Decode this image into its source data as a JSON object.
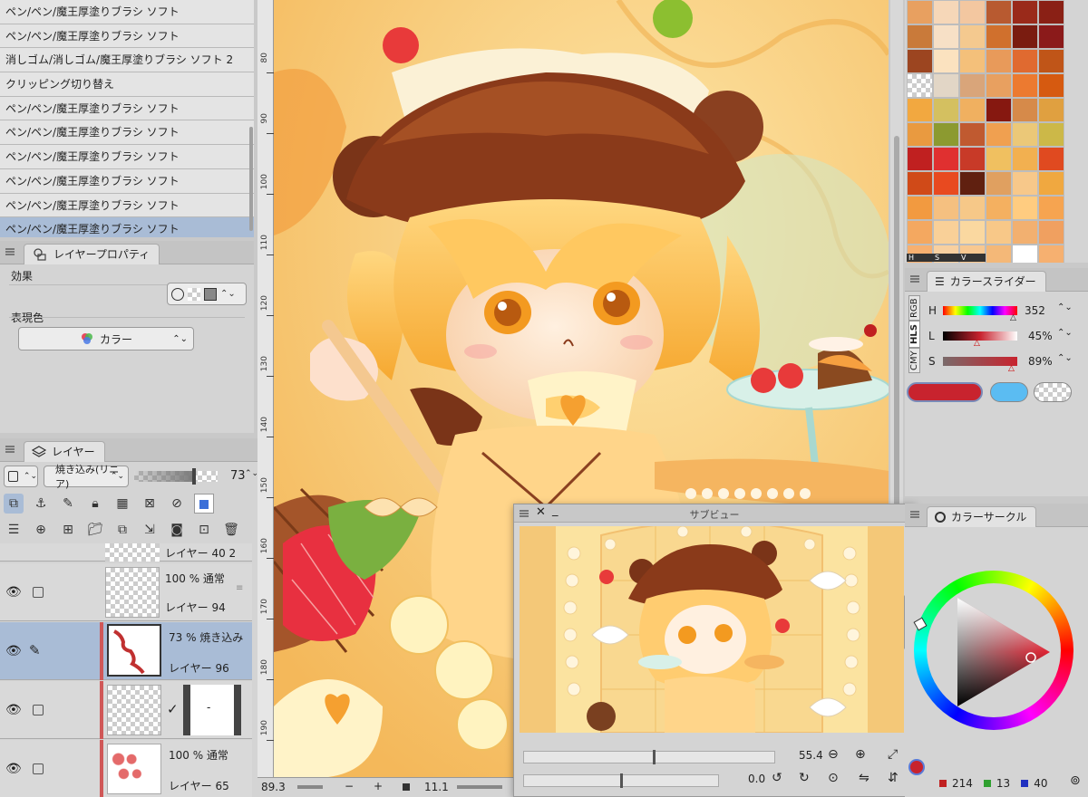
{
  "history": {
    "items": [
      "ペン/ペン/魔王厚塗りブラシ ソフト",
      "ペン/ペン/魔王厚塗りブラシ ソフト",
      "消しゴム/消しゴム/魔王厚塗りブラシ ソフト 2",
      "クリッピング切り替え",
      "ペン/ペン/魔王厚塗りブラシ ソフト",
      "ペン/ペン/魔王厚塗りブラシ ソフト",
      "ペン/ペン/魔王厚塗りブラシ ソフト",
      "ペン/ペン/魔王厚塗りブラシ ソフト",
      "ペン/ペン/魔王厚塗りブラシ ソフト",
      "ペン/ペン/魔王厚塗りブラシ ソフト"
    ]
  },
  "layer_property": {
    "tab_label": "レイヤープロパティ",
    "effect_label": "効果",
    "expression_label": "表現色",
    "expression_value": "カラー"
  },
  "layers": {
    "tab_label": "レイヤー",
    "blend_mode": "焼き込み(リニア)",
    "opacity": "73",
    "rows": [
      {
        "mode": "",
        "name": "レイヤー 40 2"
      },
      {
        "mode": "100 % 通常",
        "name": "レイヤー 94"
      },
      {
        "mode": "73 % 焼き込み",
        "name": "レイヤー 96"
      },
      {
        "mode": "",
        "name": ""
      },
      {
        "mode": "100 % 通常",
        "name": "レイヤー 65"
      }
    ],
    "mask_glyph": "-"
  },
  "canvas": {
    "ruler_marks": [
      "80",
      "90",
      "100",
      "110",
      "120",
      "130",
      "140",
      "150",
      "160",
      "170",
      "180",
      "190"
    ],
    "zoom": "89.3",
    "rotation": "11.1"
  },
  "subview": {
    "title": "サブビュー",
    "zoom": "55.4",
    "rotation": "0.0"
  },
  "color_slider": {
    "tab_label": "カラースライダー",
    "modes": [
      "RGB",
      "HLS",
      "CMY"
    ],
    "h_label": "H",
    "h_value": "352",
    "l_label": "L",
    "l_value": "45%",
    "s_label": "S",
    "s_value": "89%",
    "main_color": "#c8232e",
    "sub_color": "#5bbcf2"
  },
  "color_circle": {
    "tab_label": "カラーサークル",
    "r_value": "214",
    "g_value": "13",
    "b_value": "40"
  },
  "swatches": {
    "colors": [
      "#e8a060",
      "#f6d7b8",
      "#f3c7a0",
      "#b85a30",
      "#9a2a1a",
      "#8a2015",
      "#c97a3a",
      "#f7e0c6",
      "#f4c98f",
      "#d0702d",
      "#7a1c10",
      "#8b1a1a",
      "#9c4520",
      "#fbe2bf",
      "#f4c07a",
      "#e89a5a",
      "#e06a30",
      "#c05518",
      "checker",
      "#e2d6c6",
      "#d9a57a",
      "#e8a060",
      "#ec7a30",
      "#d65a10",
      "#f2a840",
      "#d4c060",
      "#f0b060",
      "#861810",
      "#d68a4a",
      "#e0a040",
      "#e99a40",
      "#8c9a30",
      "#c05a30",
      "#f0a050",
      "#ebc878",
      "#ccb848",
      "#c02020",
      "#e03030",
      "#c83a28",
      "#f0c060",
      "#f2b050",
      "#e04a20",
      "#d04a18",
      "#e84a20",
      "#602010",
      "#e0a060",
      "#f7c88a",
      "#f0a840",
      "#f29a40",
      "#f5c080",
      "#f6c888",
      "#f4b060",
      "#ffcc80",
      "#f6a450",
      "#f4a860",
      "#f9d098",
      "#fad8a0",
      "#f8c888",
      "#f2b070",
      "#f0a060",
      "#f7b070",
      "#f8d0a0",
      "#f8c890",
      "#f4b878",
      "#ffffff",
      "#f6b070"
    ],
    "labels": [
      "H",
      "S",
      "V"
    ]
  }
}
